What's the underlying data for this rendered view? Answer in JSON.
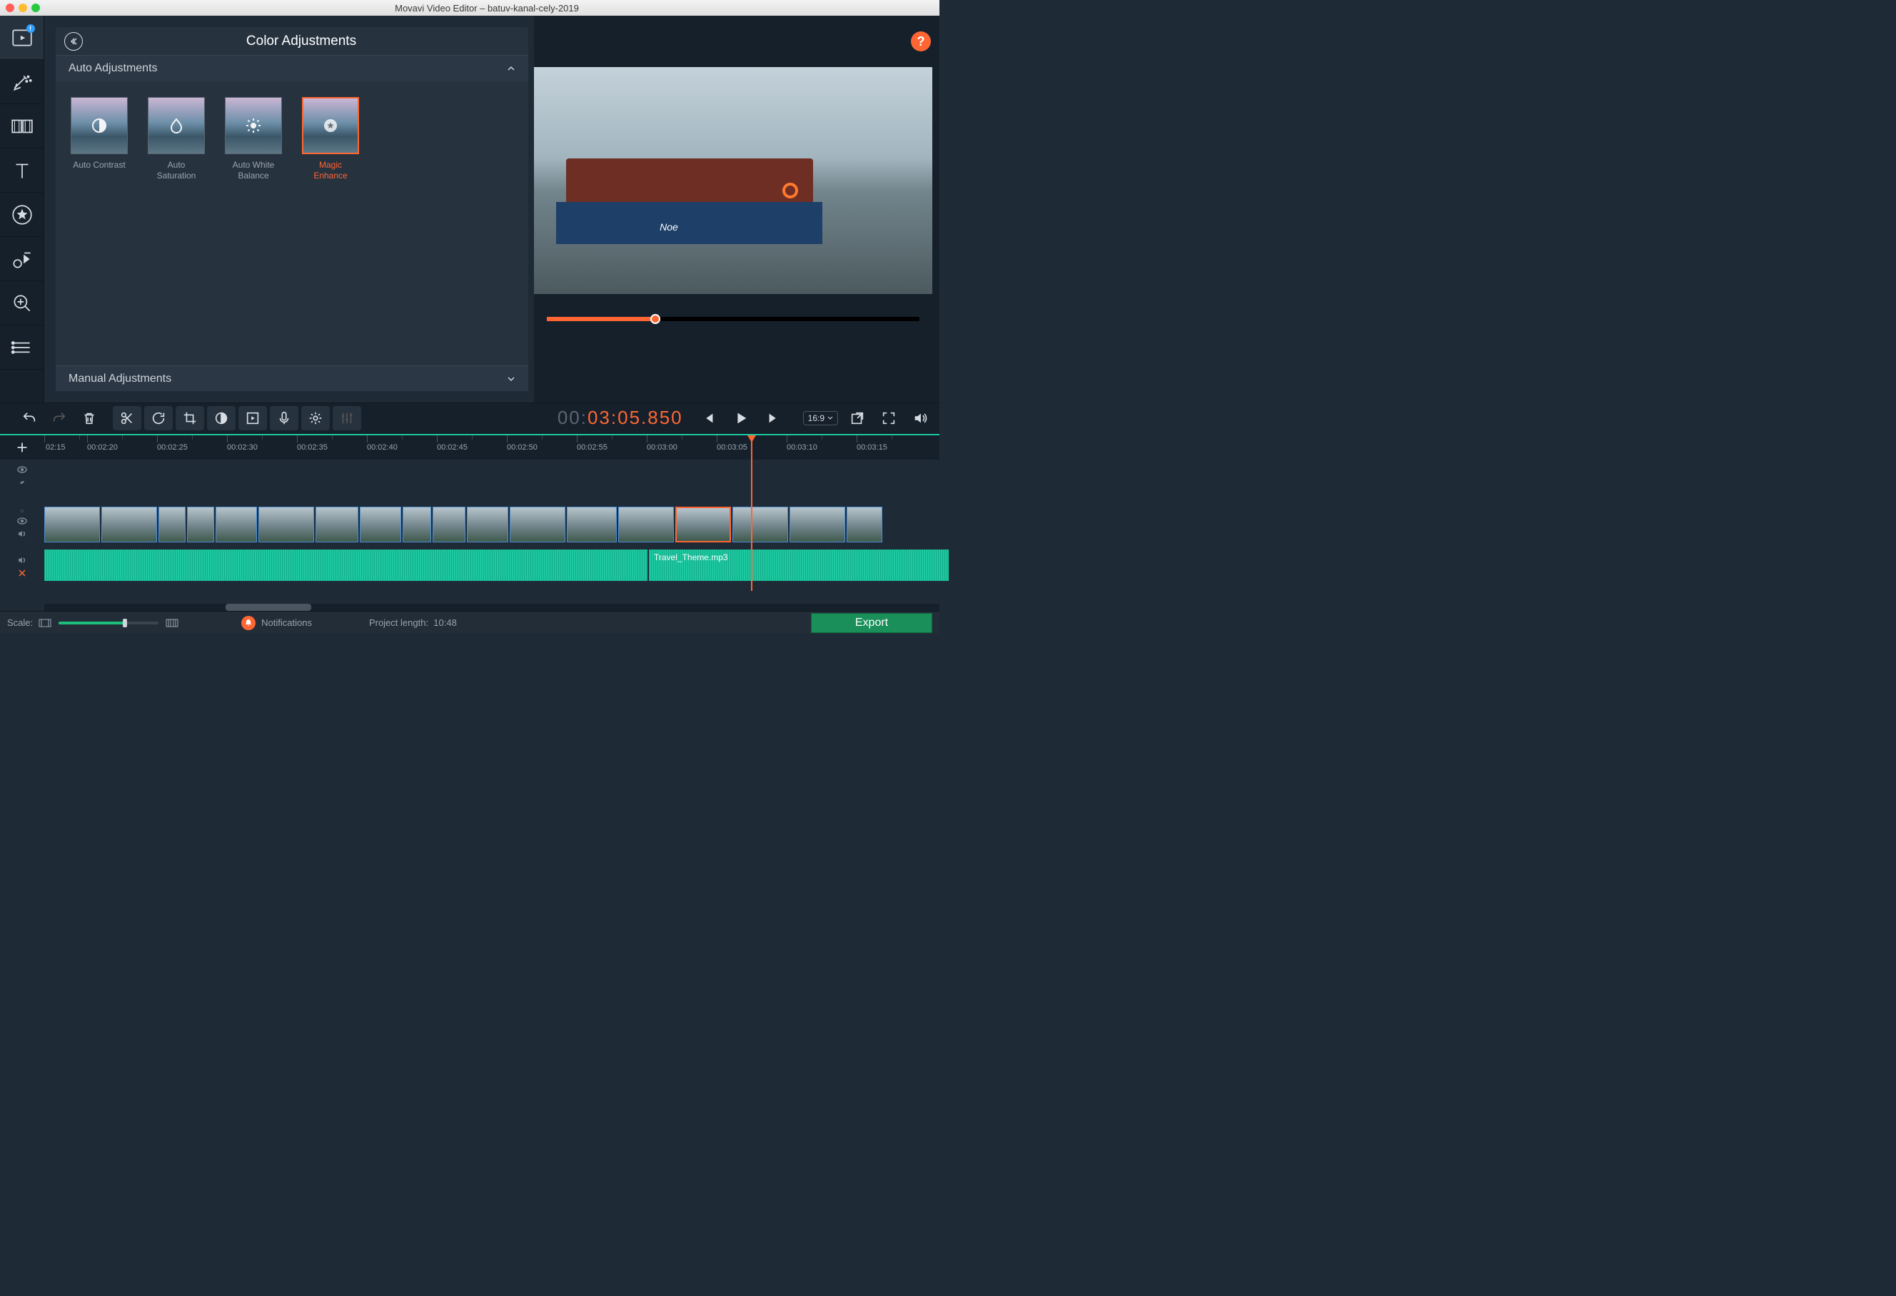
{
  "window": {
    "title": "Movavi Video Editor – batuv-kanal-cely-2019"
  },
  "panel": {
    "title": "Color Adjustments",
    "sect_auto": "Auto Adjustments",
    "sect_manual": "Manual Adjustments",
    "presets": [
      {
        "label": "Auto Contrast"
      },
      {
        "label": "Auto Saturation"
      },
      {
        "label": "Auto White Balance"
      },
      {
        "label": "Magic Enhance"
      }
    ]
  },
  "preview": {
    "boat_name": "Noe",
    "help": "?",
    "aspect_ratio": "16:9",
    "timecode": {
      "prefix": "00:",
      "main": "03:05.850"
    }
  },
  "ruler": {
    "first": "02:15",
    "ticks": [
      "00:02:20",
      "00:02:25",
      "00:02:30",
      "00:02:35",
      "00:02:40",
      "00:02:45",
      "00:02:50",
      "00:02:55",
      "00:03:00",
      "00:03:05",
      "00:03:10",
      "00:03:15"
    ]
  },
  "audio_clip_label": "Travel_Theme.mp3",
  "footer": {
    "scale_label": "Scale:",
    "notifications": "Notifications",
    "proj_len_label": "Project length:",
    "proj_len_value": "10:48",
    "export": "Export"
  }
}
